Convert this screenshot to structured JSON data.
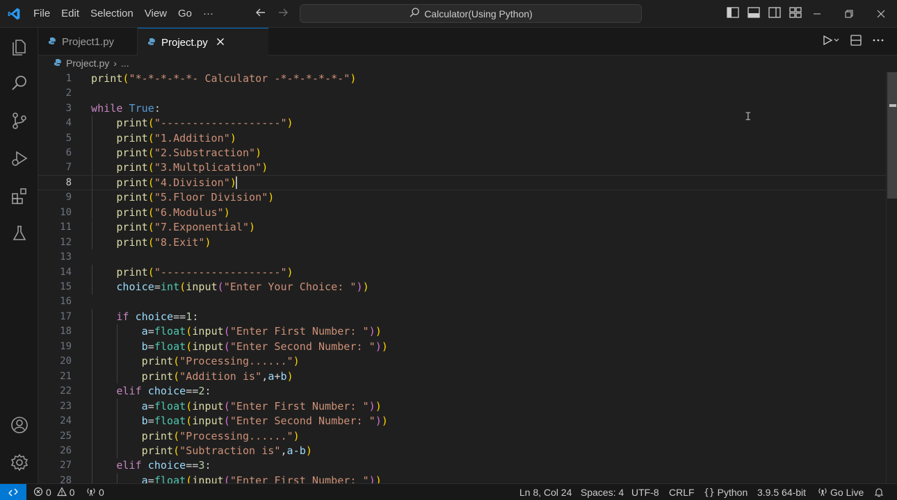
{
  "titlebar": {
    "menu": [
      "File",
      "Edit",
      "Selection",
      "View",
      "Go"
    ],
    "more": "···",
    "command_center": "Calculator(Using Python)"
  },
  "tabs": [
    {
      "label": "Project1.py",
      "active": false
    },
    {
      "label": "Project.py",
      "active": true
    }
  ],
  "breadcrumb": {
    "file": "Project.py",
    "separator": "›",
    "tail": "..."
  },
  "editor": {
    "current_line": 8,
    "lines": [
      [
        [
          "fn",
          "print"
        ],
        [
          "pu",
          "("
        ],
        [
          "str",
          "\"*-*-*-*-*- Calculator -*-*-*-*-*-\""
        ],
        [
          "pu",
          ")"
        ]
      ],
      [],
      [
        [
          "kw",
          "while"
        ],
        [
          "op",
          " "
        ],
        [
          "cst",
          "True"
        ],
        [
          "op",
          ":"
        ]
      ],
      [
        [
          "op",
          "    "
        ],
        [
          "fn",
          "print"
        ],
        [
          "pu",
          "("
        ],
        [
          "str",
          "\"-------------------\""
        ],
        [
          "pu",
          ")"
        ]
      ],
      [
        [
          "op",
          "    "
        ],
        [
          "fn",
          "print"
        ],
        [
          "pu",
          "("
        ],
        [
          "str",
          "\"1.Addition\""
        ],
        [
          "pu",
          ")"
        ]
      ],
      [
        [
          "op",
          "    "
        ],
        [
          "fn",
          "print"
        ],
        [
          "pu",
          "("
        ],
        [
          "str",
          "\"2.Substraction\""
        ],
        [
          "pu",
          ")"
        ]
      ],
      [
        [
          "op",
          "    "
        ],
        [
          "fn",
          "print"
        ],
        [
          "pu",
          "("
        ],
        [
          "str",
          "\"3.Multplication\""
        ],
        [
          "pu",
          ")"
        ]
      ],
      [
        [
          "op",
          "    "
        ],
        [
          "fn",
          "print"
        ],
        [
          "pu",
          "("
        ],
        [
          "str",
          "\"4.Division\""
        ],
        [
          "pu",
          ")"
        ],
        [
          "cursor",
          ""
        ]
      ],
      [
        [
          "op",
          "    "
        ],
        [
          "fn",
          "print"
        ],
        [
          "pu",
          "("
        ],
        [
          "str",
          "\"5.Floor Division\""
        ],
        [
          "pu",
          ")"
        ]
      ],
      [
        [
          "op",
          "    "
        ],
        [
          "fn",
          "print"
        ],
        [
          "pu",
          "("
        ],
        [
          "str",
          "\"6.Modulus\""
        ],
        [
          "pu",
          ")"
        ]
      ],
      [
        [
          "op",
          "    "
        ],
        [
          "fn",
          "print"
        ],
        [
          "pu",
          "("
        ],
        [
          "str",
          "\"7.Exponential\""
        ],
        [
          "pu",
          ")"
        ]
      ],
      [
        [
          "op",
          "    "
        ],
        [
          "fn",
          "print"
        ],
        [
          "pu",
          "("
        ],
        [
          "str",
          "\"8.Exit\""
        ],
        [
          "pu",
          ")"
        ]
      ],
      [],
      [
        [
          "op",
          "    "
        ],
        [
          "fn",
          "print"
        ],
        [
          "pu",
          "("
        ],
        [
          "str",
          "\"-------------------\""
        ],
        [
          "pu",
          ")"
        ]
      ],
      [
        [
          "op",
          "    "
        ],
        [
          "var",
          "choice"
        ],
        [
          "op",
          "="
        ],
        [
          "bi",
          "int"
        ],
        [
          "pu",
          "("
        ],
        [
          "fn",
          "input"
        ],
        [
          "pv",
          "("
        ],
        [
          "str",
          "\"Enter Your Choice: \""
        ],
        [
          "pv",
          ")"
        ],
        [
          "pu",
          ")"
        ]
      ],
      [],
      [
        [
          "op",
          "    "
        ],
        [
          "kw",
          "if"
        ],
        [
          "op",
          " "
        ],
        [
          "var",
          "choice"
        ],
        [
          "op",
          "=="
        ],
        [
          "num",
          "1"
        ],
        [
          "op",
          ":"
        ]
      ],
      [
        [
          "op",
          "        "
        ],
        [
          "var",
          "a"
        ],
        [
          "op",
          "="
        ],
        [
          "bi",
          "float"
        ],
        [
          "pu",
          "("
        ],
        [
          "fn",
          "input"
        ],
        [
          "pv",
          "("
        ],
        [
          "str",
          "\"Enter First Number: \""
        ],
        [
          "pv",
          ")"
        ],
        [
          "pu",
          ")"
        ]
      ],
      [
        [
          "op",
          "        "
        ],
        [
          "var",
          "b"
        ],
        [
          "op",
          "="
        ],
        [
          "bi",
          "float"
        ],
        [
          "pu",
          "("
        ],
        [
          "fn",
          "input"
        ],
        [
          "pv",
          "("
        ],
        [
          "str",
          "\"Enter Second Number: \""
        ],
        [
          "pv",
          ")"
        ],
        [
          "pu",
          ")"
        ]
      ],
      [
        [
          "op",
          "        "
        ],
        [
          "fn",
          "print"
        ],
        [
          "pu",
          "("
        ],
        [
          "str",
          "\"Processing......\""
        ],
        [
          "pu",
          ")"
        ]
      ],
      [
        [
          "op",
          "        "
        ],
        [
          "fn",
          "print"
        ],
        [
          "pu",
          "("
        ],
        [
          "str",
          "\"Addition is\""
        ],
        [
          "op",
          ","
        ],
        [
          "var",
          "a"
        ],
        [
          "op",
          "+"
        ],
        [
          "var",
          "b"
        ],
        [
          "pu",
          ")"
        ]
      ],
      [
        [
          "op",
          "    "
        ],
        [
          "kw",
          "elif"
        ],
        [
          "op",
          " "
        ],
        [
          "var",
          "choice"
        ],
        [
          "op",
          "=="
        ],
        [
          "num",
          "2"
        ],
        [
          "op",
          ":"
        ]
      ],
      [
        [
          "op",
          "        "
        ],
        [
          "var",
          "a"
        ],
        [
          "op",
          "="
        ],
        [
          "bi",
          "float"
        ],
        [
          "pu",
          "("
        ],
        [
          "fn",
          "input"
        ],
        [
          "pv",
          "("
        ],
        [
          "str",
          "\"Enter First Number: \""
        ],
        [
          "pv",
          ")"
        ],
        [
          "pu",
          ")"
        ]
      ],
      [
        [
          "op",
          "        "
        ],
        [
          "var",
          "b"
        ],
        [
          "op",
          "="
        ],
        [
          "bi",
          "float"
        ],
        [
          "pu",
          "("
        ],
        [
          "fn",
          "input"
        ],
        [
          "pv",
          "("
        ],
        [
          "str",
          "\"Enter Second Number: \""
        ],
        [
          "pv",
          ")"
        ],
        [
          "pu",
          ")"
        ]
      ],
      [
        [
          "op",
          "        "
        ],
        [
          "fn",
          "print"
        ],
        [
          "pu",
          "("
        ],
        [
          "str",
          "\"Processing......\""
        ],
        [
          "pu",
          ")"
        ]
      ],
      [
        [
          "op",
          "        "
        ],
        [
          "fn",
          "print"
        ],
        [
          "pu",
          "("
        ],
        [
          "str",
          "\"Subtraction is\""
        ],
        [
          "op",
          ","
        ],
        [
          "var",
          "a"
        ],
        [
          "op",
          "-"
        ],
        [
          "var",
          "b"
        ],
        [
          "pu",
          ")"
        ]
      ],
      [
        [
          "op",
          "    "
        ],
        [
          "kw",
          "elif"
        ],
        [
          "op",
          " "
        ],
        [
          "var",
          "choice"
        ],
        [
          "op",
          "=="
        ],
        [
          "num",
          "3"
        ],
        [
          "op",
          ":"
        ]
      ],
      [
        [
          "op",
          "        "
        ],
        [
          "var",
          "a"
        ],
        [
          "op",
          "="
        ],
        [
          "bi",
          "float"
        ],
        [
          "pu",
          "("
        ],
        [
          "fn",
          "input"
        ],
        [
          "pv",
          "("
        ],
        [
          "str",
          "\"Enter First Number: \""
        ],
        [
          "pv",
          ")"
        ],
        [
          "pu",
          ")"
        ]
      ]
    ]
  },
  "statusbar": {
    "errors": "0",
    "warnings": "0",
    "ports": "0",
    "position": "Ln 8, Col 24",
    "spaces": "Spaces: 4",
    "encoding": "UTF-8",
    "eol": "CRLF",
    "language": "Python",
    "interpreter": "3.9.5 64-bit",
    "go_live": "Go Live"
  },
  "colors": {
    "accent": "#0078d4",
    "background": "#1f1f1f",
    "sidebar": "#181818"
  }
}
